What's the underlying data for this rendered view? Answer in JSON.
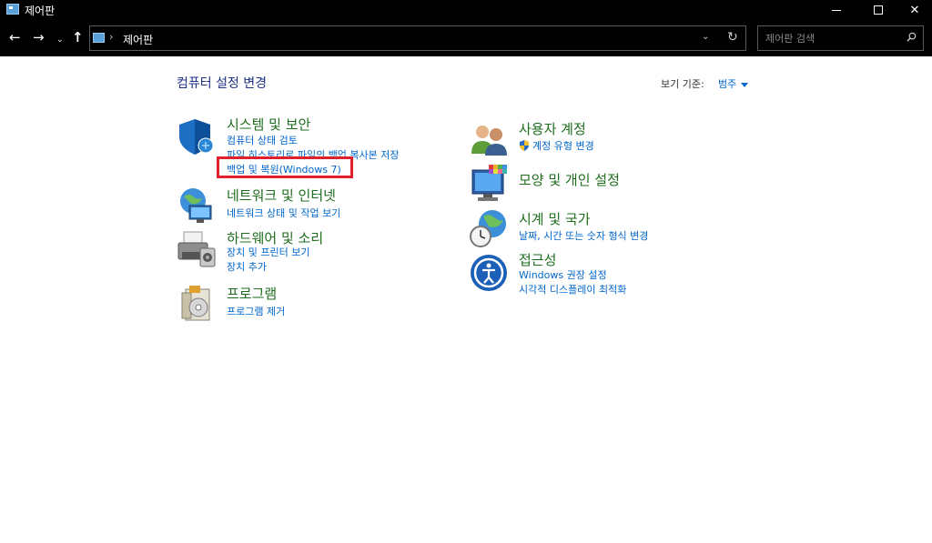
{
  "window": {
    "title": "제어판",
    "minimize_glyph": "–",
    "maximize_glyph": "☐",
    "close_glyph": "✕"
  },
  "nav": {
    "back_glyph": "←",
    "forward_glyph": "→",
    "recent_glyph": "⌄",
    "up_glyph": "↑",
    "breadcrumb": "제어판",
    "breadcrumb_sep": "›",
    "dropdown_glyph": "⌄",
    "refresh_glyph": "↻"
  },
  "search": {
    "placeholder": "제어판 검색"
  },
  "content": {
    "title": "컴퓨터 설정 변경",
    "viewby_label": "보기 기준:",
    "viewby_value": "범주",
    "categories": [
      {
        "icon": "security-shield-icon",
        "title": "시스템 및 보안",
        "links": [
          "컴퓨터 상태 검토",
          "파일 히스토리로 파일의 백업 복사본 저장",
          "백업 및 복원(Windows 7)"
        ]
      },
      {
        "icon": "network-globe-icon",
        "title": "네트워크 및 인터넷",
        "links": [
          "네트워크 상태 및 작업 보기"
        ]
      },
      {
        "icon": "printer-icon",
        "title": "하드웨어 및 소리",
        "links": [
          "장치 및 프린터 보기",
          "장치 추가"
        ]
      },
      {
        "icon": "programs-disc-icon",
        "title": "프로그램",
        "links": [
          "프로그램 제거"
        ]
      },
      {
        "icon": "users-icon",
        "title": "사용자 계정",
        "links": [
          "계정 유형 변경"
        ]
      },
      {
        "icon": "appearance-monitor-icon",
        "title": "모양 및 개인 설정",
        "links": []
      },
      {
        "icon": "clock-globe-icon",
        "title": "시계 및 국가",
        "links": [
          "날짜, 시간 또는 숫자 형식 변경"
        ]
      },
      {
        "icon": "accessibility-icon",
        "title": "접근성",
        "links": [
          "Windows 권장 설정",
          "시각적 디스플레이 최적화"
        ]
      }
    ]
  },
  "colors": {
    "accent_link": "#0066cc",
    "category_title": "#1e6e1e",
    "page_title": "#1e3287",
    "highlight": "#e0202a"
  }
}
